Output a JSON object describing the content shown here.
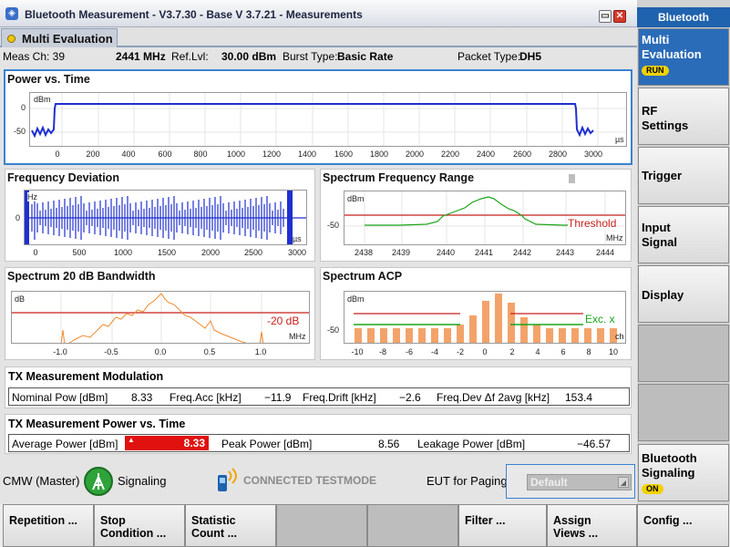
{
  "window": {
    "title": "Bluetooth Measurement  - V3.7.30 - Base V 3.7.21 - Measurements",
    "app_icon": "logo-icon",
    "minimize": "▭",
    "close": "✕"
  },
  "tab": {
    "label": "Multi Evaluation"
  },
  "info": {
    "meas_ch_label": "Meas Ch: 39",
    "freq": "2441 MHz",
    "ref_lvl_label": "Ref.Lvl:",
    "ref_lvl_value": "30.00 dBm",
    "burst_label": "Burst Type:",
    "burst_value": "Basic Rate",
    "packet_label": "Packet Type:",
    "packet_value": "DH5"
  },
  "pvt": {
    "title": "Power vs. Time",
    "y_unit": "dBm",
    "x_unit": "µs",
    "y_ticks": [
      "0",
      "-50"
    ],
    "x_ticks": [
      "0",
      "200",
      "400",
      "600",
      "800",
      "1000",
      "1200",
      "1400",
      "1600",
      "1800",
      "2000",
      "2200",
      "2400",
      "2600",
      "2800",
      "3000"
    ]
  },
  "fdev": {
    "title": "Frequency Deviation",
    "y_unit": "Hz",
    "x_unit": "µs",
    "y_ticks": [
      "0"
    ],
    "x_ticks": [
      "0",
      "500",
      "1000",
      "1500",
      "2000",
      "2500",
      "3000"
    ]
  },
  "sfr": {
    "title": "Spectrum Frequency Range",
    "y_unit": "dBm",
    "x_unit": "MHz",
    "y_ticks": [
      "-50"
    ],
    "x_ticks": [
      "2438",
      "2439",
      "2440",
      "2441",
      "2442",
      "2443",
      "2444"
    ],
    "threshold_label": "Threshold"
  },
  "bw": {
    "title": "Spectrum 20 dB Bandwidth",
    "y_unit": "dB",
    "x_unit": "MHz",
    "x_ticks": [
      "-1.0",
      "-0.5",
      "0.0",
      "0.5",
      "1.0"
    ],
    "marker_label": "-20 dB"
  },
  "acp": {
    "title": "Spectrum ACP",
    "y_unit": "dBm",
    "x_unit": "ch",
    "y_ticks": [
      "-50"
    ],
    "x_ticks": [
      "-10",
      "-8",
      "-6",
      "-4",
      "-2",
      "0",
      "2",
      "4",
      "6",
      "8",
      "10"
    ],
    "legend_label": "Exc. x"
  },
  "tx_mod": {
    "title": "TX Measurement Modulation",
    "nominal_label": "Nominal Pow [dBm]",
    "nominal_value": "8.33",
    "freq_acc_label": "Freq.Acc [kHz]",
    "freq_acc_value": "−11.9",
    "freq_drift_label": "Freq.Drift [kHz]",
    "freq_drift_value": "−2.6",
    "freq_dev_label": "Freq.Dev Δf 2avg [kHz]",
    "freq_dev_value": "153.4"
  },
  "tx_pvt": {
    "title": "TX Measurement Power vs. Time",
    "avg_label": "Average Power [dBm]",
    "avg_value": "8.33",
    "peak_label": "Peak Power [dBm]",
    "peak_value": "8.56",
    "leak_label": "Leakage Power [dBm]",
    "leak_value": "−46.57"
  },
  "status": {
    "cmw_label": "CMW (Master)",
    "signaling_label": "Signaling",
    "connected_label": "CONNECTED TESTMODE",
    "eut_label": "EUT for Paging",
    "eut_select": "Default"
  },
  "softkeys": {
    "repetition": "Repetition ...",
    "stop_line1": "Stop",
    "stop_line2": "Condition ...",
    "statistic_line1": "Statistic",
    "statistic_line2": "Count ...",
    "filter": "Filter ...",
    "assign_line1": "Assign",
    "assign_line2": "Views ...",
    "config": "Config ..."
  },
  "sidebar": {
    "header": "Bluetooth",
    "multi_line1": "Multi",
    "multi_line2": "Evaluation",
    "multi_badge": "RUN",
    "rf_line1": "RF",
    "rf_line2": "Settings",
    "trigger": "Trigger",
    "input_line1": "Input",
    "input_line2": "Signal",
    "display": "Display",
    "bt_line1": "Bluetooth",
    "bt_line2": "Signaling",
    "bt_badge": "ON"
  },
  "colors": {
    "trace_blue": "#1f2fd0",
    "trace_green": "#1aa51a",
    "trace_orange": "#f08a2c",
    "limit_red": "#c8201c",
    "alarm_red": "#e0110f",
    "accent_blue": "#1f62ad",
    "badge_yellow": "#f2d200"
  }
}
